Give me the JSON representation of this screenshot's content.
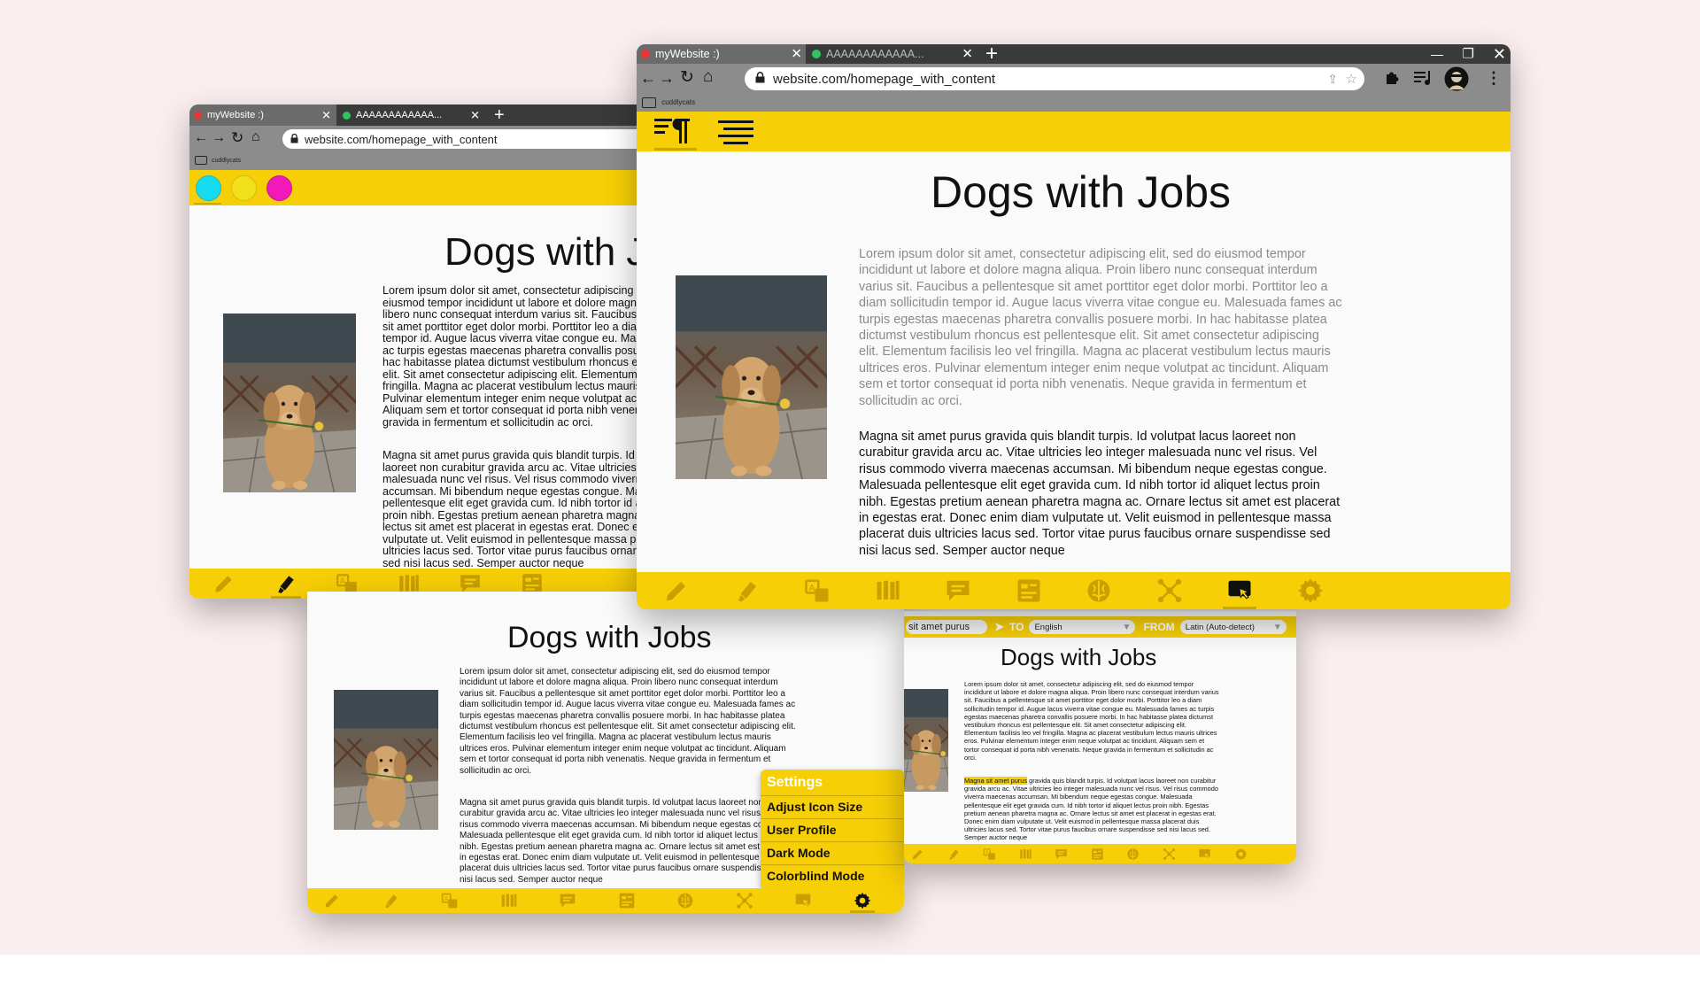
{
  "browser": {
    "tabs": [
      {
        "title": "myWebsite :)",
        "favicon_color": "#ee3333"
      },
      {
        "title": "AAAAAAAAAAAA...",
        "favicon_color": "#2fc462"
      }
    ],
    "new_tab": "+",
    "url": "website.com/homepage_with_content",
    "bookmark": "cuddlycats",
    "window_controls": {
      "minimize": "—",
      "restore": "❐",
      "close": "✕"
    }
  },
  "article": {
    "title": "Dogs with Jobs",
    "paragraph1": "Lorem ipsum dolor sit amet, consectetur adipiscing elit, sed do eiusmod tempor incididunt ut labore et dolore magna aliqua. Proin libero nunc consequat interdum varius sit. Faucibus a pellentesque sit amet porttitor eget dolor morbi. Porttitor leo a diam sollicitudin tempor id. Augue lacus viverra vitae congue eu. Malesuada fames ac turpis egestas maecenas pharetra convallis posuere morbi. In hac habitasse platea dictumst vestibulum rhoncus est pellentesque elit. Sit amet consectetur adipiscing elit. Elementum facilisis leo vel fringilla. Magna ac placerat vestibulum lectus mauris ultrices eros. Pulvinar elementum integer enim neque volutpat ac tincidunt. Aliquam sem et tortor consequat id porta nibh venenatis. Neque gravida in fermentum et sollicitudin ac orci.",
    "paragraph2": "Magna sit amet purus gravida quis blandit turpis. Id volutpat lacus laoreet non curabitur gravida arcu ac. Vitae ultricies leo integer malesuada nunc vel risus. Vel risus commodo viverra maecenas accumsan. Mi bibendum neque egestas congue. Malesuada pellentesque elit eget gravida cum. Id nibh tortor id aliquet lectus proin nibh. Egestas pretium aenean pharetra magna ac. Ornare lectus sit amet est placerat in egestas erat. Donec enim diam vulputate ut. Velit euismod in pellentesque massa placerat duis ultricies lacus sed. Tortor vitae purus faucibus ornare suspendisse sed nisi lacus sed. Semper auctor neque",
    "highlight": "Magna sit amet purus",
    "paragraph2_rest": " gravida quis blandit turpis. Id volutpat lacus laoreet non curabitur gravida arcu ac. Vitae ultricies leo integer malesuada nunc vel risus. Vel risus commodo viverra maecenas accumsan. Mi bibendum neque egestas congue. Malesuada pellentesque elit eget gravida cum. Id nibh tortor id aliquet lectus proin nibh. Egestas pretium aenean pharetra magna ac. Ornare lectus sit amet est placerat in egestas erat. Donec enim diam vulputate ut. Velit euismod in pellentesque massa placerat duis ultricies lacus sed. Tortor vitae purus faucibus ornare suspendisse sed nisi lacus sed. Semper auctor neque"
  },
  "color_dots": [
    "#17dcef",
    "#f2e01b",
    "#f119b7"
  ],
  "toolbar_icons": [
    "pencil-icon",
    "highlighter-icon",
    "translate-icon",
    "columns-icon",
    "comment-icon",
    "reader-icon",
    "brain-icon",
    "network-icon",
    "cursor-icon",
    "gear-icon"
  ],
  "settings_menu": {
    "title": "Settings",
    "items": [
      "Adjust Icon Size",
      "User Profile",
      "Dark Mode",
      "Colorblind Mode"
    ]
  },
  "translate_bar": {
    "selected_text": "sit amet purus",
    "to_label": "TO",
    "to_value": "English",
    "from_label": "FROM",
    "from_value": "Latin  (Auto-detect)",
    "dropdown_arrow": "▼",
    "arrow": "➤"
  },
  "colors": {
    "accent": "#f7cf06",
    "tab_bar": "#3a3a3a",
    "address_bar": "#8c8c8c",
    "icon_inactive": "#c9a000",
    "icon_active": "#111111"
  }
}
